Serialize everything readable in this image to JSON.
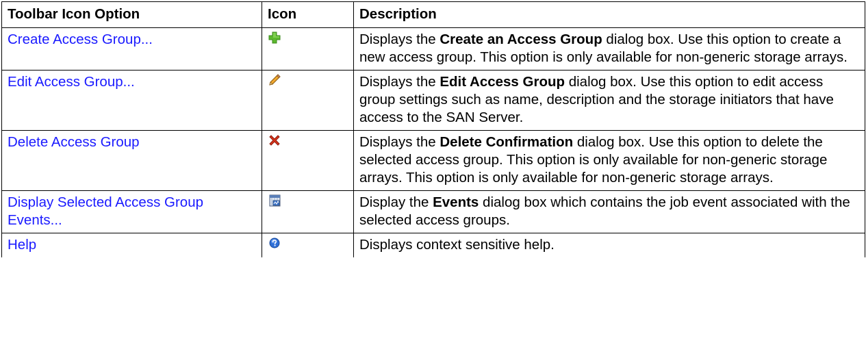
{
  "table": {
    "headers": {
      "option": "Toolbar Icon Option",
      "icon": "Icon",
      "description": "Description"
    },
    "rows": [
      {
        "option": "Create Access Group...",
        "icon": "plus-icon",
        "desc_pre": "Displays the ",
        "desc_bold": "Create an Access Group",
        "desc_post": " dialog box. Use this option to create a new access group. This option is only available for non-generic storage arrays."
      },
      {
        "option": "Edit Access Group...",
        "icon": "pencil-icon",
        "desc_pre": "Displays the ",
        "desc_bold": "Edit Access Group",
        "desc_post": " dialog box. Use this option to edit access group settings such as name, description and the storage initiators that have access to the SAN Server."
      },
      {
        "option": "Delete Access Group",
        "icon": "delete-x-icon",
        "desc_pre": "Displays the ",
        "desc_bold": "Delete Confirmation",
        "desc_post": " dialog box. Use this option to delete the selected access group. This option is only available for non-generic storage arrays. This option is only available for non-generic storage arrays."
      },
      {
        "option": "Display Selected Access Group Events...",
        "icon": "events-icon",
        "desc_pre": "Display the ",
        "desc_bold": "Events",
        "desc_post": " dialog box which contains the job event associated with the selected access groups."
      },
      {
        "option": "Help",
        "icon": "help-icon",
        "desc_plain": "Displays context sensitive help."
      }
    ]
  },
  "colors": {
    "link": "#1a1aff",
    "border": "#000000",
    "plus_icon": "#5cb82e",
    "delete_icon": "#d9341c",
    "help_icon": "#2f6fd6"
  }
}
